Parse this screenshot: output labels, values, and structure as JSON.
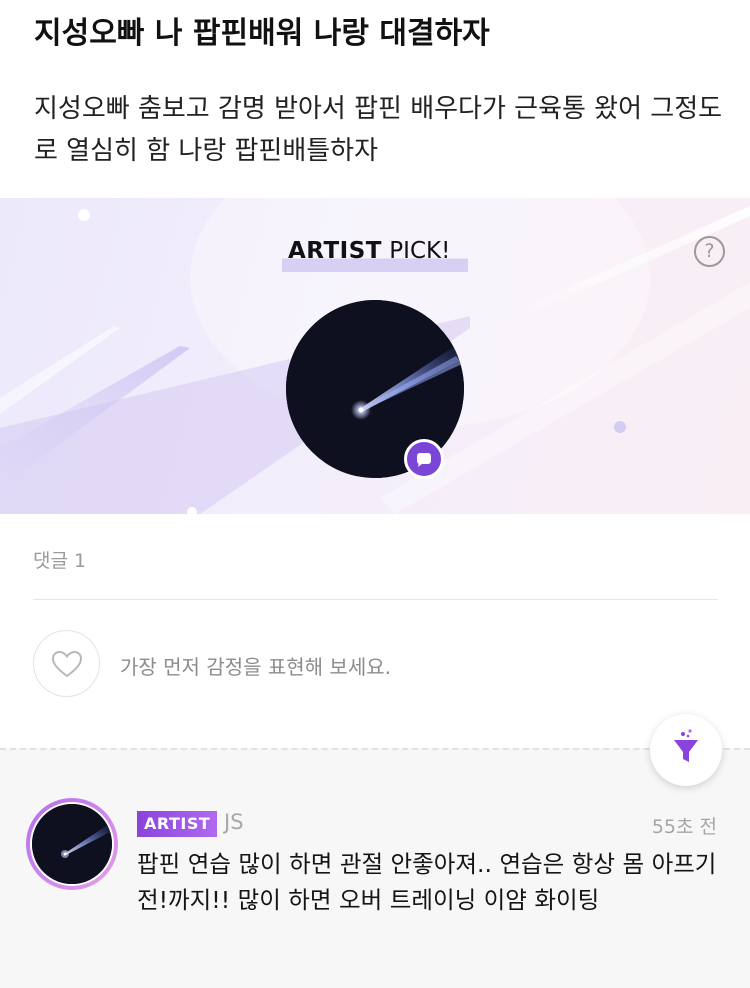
{
  "post": {
    "title": "지성오빠 나 팝핀배워 나랑 대결하자",
    "body": "지성오빠 춤보고 감명 받아서 팝핀 배우다가 근육통 왔어 그정도로 열심히 함 나랑 팝핀배틀하자"
  },
  "artist_pick": {
    "label_bold": "ARTIST",
    "label_rest": " PICK!",
    "help_symbol": "?",
    "avatar_icon": "shooting-star-image",
    "badge_icon": "chat-bubble-icon"
  },
  "reactions": {
    "comment_count": "댓글 1",
    "prompt": "가장 먼저 감정을 표현해 보세요.",
    "heart_icon": "heart-outline-icon",
    "filter_icon": "filter-funnel-icon"
  },
  "comment": {
    "badge": "ARTIST",
    "author": "JS",
    "time": "55초 전",
    "text": "팝핀 연습 많이 하면 관절 안좋아져.. 연습은 항상 몸 아프기 전!까지!! 많이 하면 오버 트레이닝 이얌 화이팅"
  },
  "colors": {
    "accent": "#7b46d8",
    "badge_gradient_start": "#8a44dd",
    "badge_gradient_end": "#b069ee",
    "banner_tint": "#ece9fb"
  }
}
